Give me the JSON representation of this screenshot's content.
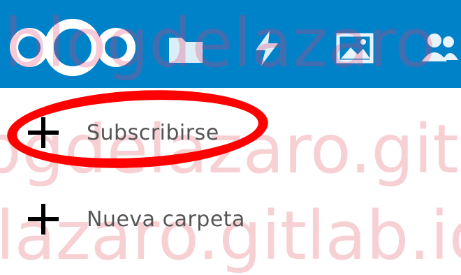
{
  "topbar": {
    "background": "#0082c9",
    "logo_icon": "nextcloud-logo-icon",
    "app_icons": [
      "files-folder-icon",
      "activity-lightning-icon",
      "gallery-image-icon",
      "contacts-icon"
    ]
  },
  "menu": {
    "items": [
      {
        "label": "Subscribirse",
        "icon": "plus-icon"
      },
      {
        "label": "Nueva carpeta",
        "icon": "plus-icon"
      }
    ]
  },
  "annotation": {
    "color": "#ff0000"
  },
  "watermark": {
    "line1": "blogdelazaro",
    "line2": "bgdelazaro.gitla",
    "line3": "lazaro.gitlab.io"
  }
}
